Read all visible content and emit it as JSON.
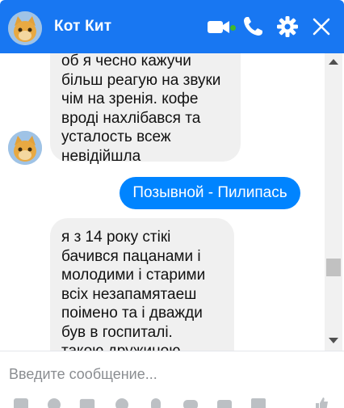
{
  "header": {
    "title": "Кот Кит",
    "icons": [
      "video-icon",
      "phone-icon",
      "gear-icon",
      "close-icon"
    ],
    "accent": "#1877f2"
  },
  "messages": [
    {
      "side": "in",
      "lines": [
        "об я чесно кажучи",
        "більш реагую на звуки",
        "чім на зренія. кофе",
        "вроді нахлібався та",
        "усталость всеж",
        "невідійшла"
      ]
    },
    {
      "side": "out",
      "text": "Позывной - Пилипась"
    },
    {
      "side": "in",
      "lines": [
        "я з 14 року стікі",
        "бачився пацанами і",
        "молодими і старими",
        "всіх незапамятаеш",
        "поімено та і дважди",
        "був в госпиталі.",
        "такою дружиною"
      ]
    }
  ],
  "composer": {
    "placeholder": "Введите сообщение..."
  },
  "colors": {
    "outgoing_bubble": "#0084ff",
    "incoming_bubble": "#f0f0f0"
  }
}
